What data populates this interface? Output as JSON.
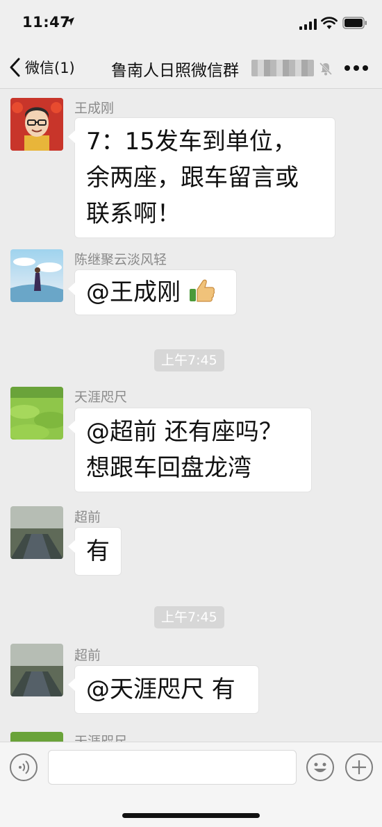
{
  "status_bar": {
    "time": "11:47"
  },
  "nav": {
    "back_label": "微信(1)",
    "title": "鲁南人日照微信群",
    "icons": [
      "back-chevron-icon",
      "mute-bell-icon",
      "more-icon"
    ]
  },
  "messages": [
    {
      "sender": "王成刚",
      "lines": [
        "7：15发车到单位，",
        "余两座，跟车留言或",
        "联系啊！"
      ]
    },
    {
      "sender": "陈继聚云淡风轻",
      "text": "@王成刚"
    },
    {
      "timestamp": "上午7:45"
    },
    {
      "sender": "天涯咫尺",
      "lines": [
        "@超前 还有座吗？",
        "想跟车回盘龙湾"
      ]
    },
    {
      "sender": "超前",
      "text": "有"
    },
    {
      "timestamp": "上午7:45"
    },
    {
      "sender": "超前",
      "text": "@天涯咫尺 有"
    },
    {
      "sender": "天涯咫尺"
    }
  ],
  "input_bar": {
    "icons": [
      "voice-icon",
      "emoji-icon",
      "add-icon"
    ]
  }
}
